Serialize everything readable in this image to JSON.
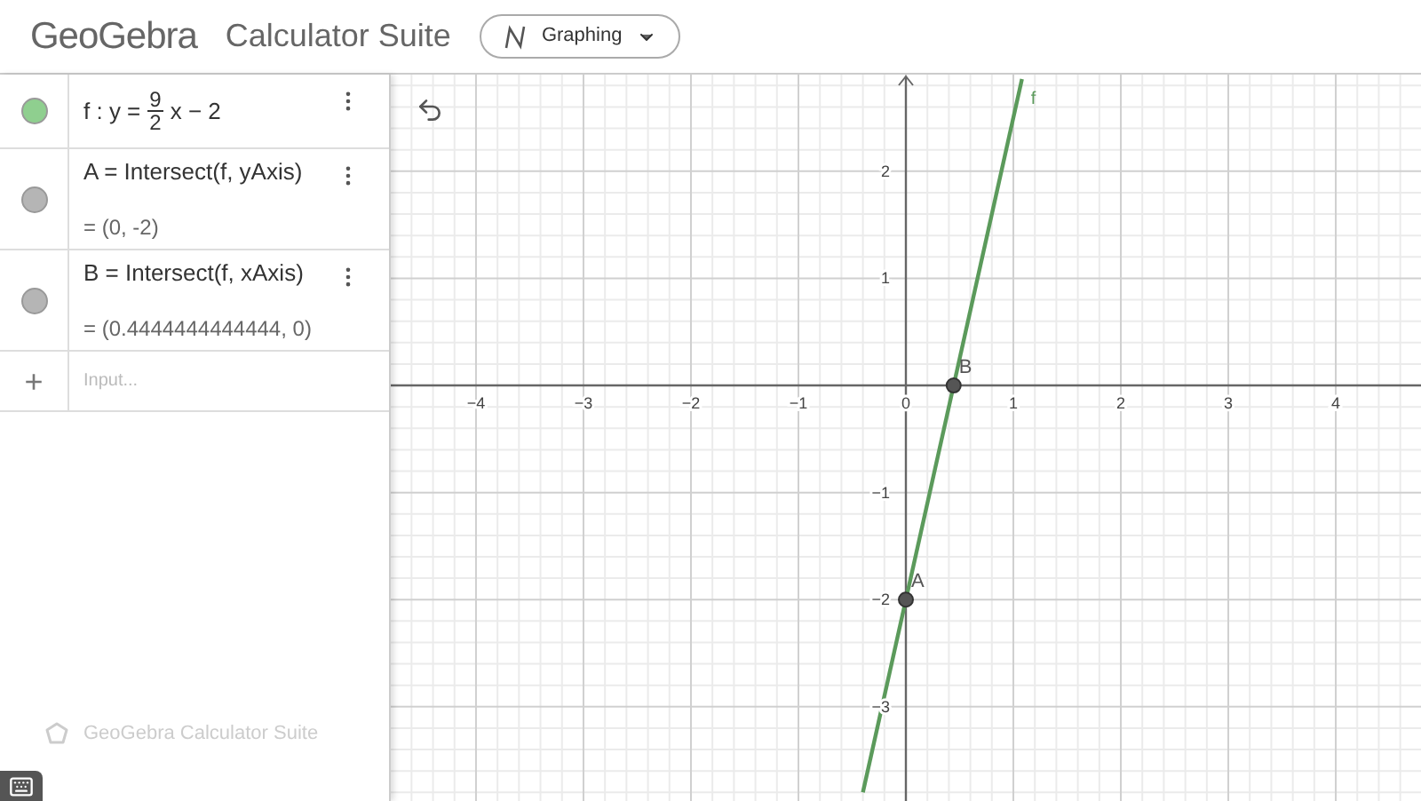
{
  "header": {
    "logo": "GeoGebra",
    "title": "Calculator Suite",
    "app_menu": {
      "label": "Graphing"
    }
  },
  "algebra": {
    "items": [
      {
        "kind": "function",
        "color": "#8fcf8f",
        "label": "f : y =",
        "numerator": "9",
        "denominator": "2",
        "rest": "x − 2"
      },
      {
        "kind": "point",
        "color": "#b5b5b5",
        "definition": "A = Intersect(f, yAxis)",
        "value": "= (0, -2)"
      },
      {
        "kind": "point",
        "color": "#b5b5b5",
        "definition": "B = Intersect(f, xAxis)",
        "value": "= (0.4444444444444, 0)"
      }
    ],
    "input": {
      "icon": "+",
      "placeholder": "Input..."
    },
    "footer": "GeoGebra Calculator Suite"
  },
  "graphics": {
    "chart_data": {
      "type": "line",
      "x": [
        -0.4,
        1.08
      ],
      "series": [
        {
          "name": "f",
          "color": "#5b9a5b",
          "values": [
            -3.8,
            2.86
          ]
        }
      ],
      "grid": true,
      "xlim": [
        -4.793,
        4.793
      ],
      "ylim": [
        -3.88,
        2.902
      ],
      "xticks": [
        {
          "value": -4,
          "label": "−4"
        },
        {
          "value": -3,
          "label": "−3"
        },
        {
          "value": -2,
          "label": "−2"
        },
        {
          "value": -1,
          "label": "−1"
        },
        {
          "value": 0,
          "label": "0"
        },
        1,
        2,
        3,
        4
      ],
      "yticks": [
        {
          "value": -3,
          "label": "−3"
        },
        {
          "value": -2,
          "label": "−2"
        },
        {
          "value": -1,
          "label": "−1"
        },
        1,
        2
      ],
      "annotations": [
        {
          "text": "A",
          "x": 0,
          "y": -2
        },
        {
          "text": "B",
          "x": 0.4444,
          "y": 0
        }
      ]
    }
  }
}
